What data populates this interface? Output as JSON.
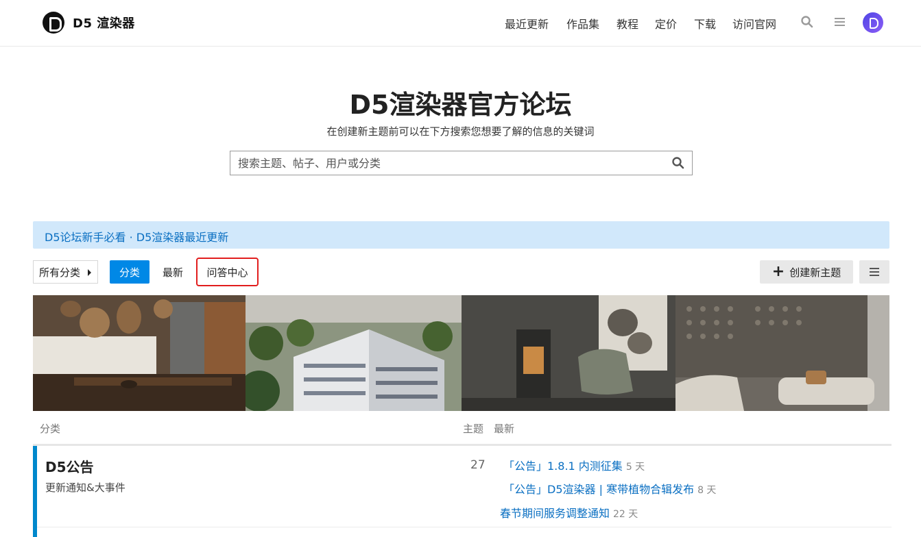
{
  "header": {
    "logo_text": "D5 渲染器",
    "nav": [
      "最近更新",
      "作品集",
      "教程",
      "定价",
      "下载",
      "访问官网"
    ]
  },
  "hero": {
    "title": "D5渲染器官方论坛",
    "subtitle": "在创建新主题前可以在下方搜索您想要了解的信息的关键词",
    "search_placeholder": "搜索主题、帖子、用户或分类"
  },
  "banner": {
    "text": "D5论坛新手必看 · D5渲染器最近更新"
  },
  "filters": {
    "dropdown": "所有分类",
    "categories": "分类",
    "latest": "最新",
    "qa": "问答中心",
    "create": "创建新主题"
  },
  "table": {
    "col_category": "分类",
    "col_topics": "主题",
    "col_latest": "最新"
  },
  "category": {
    "name": "D5公告",
    "description": "更新通知&大事件",
    "count": "27",
    "topics": [
      {
        "title": "「公告」1.8.1 内测征集",
        "age": "5 天"
      },
      {
        "title": "「公告」D5渲染器 | 寒带植物合辑发布",
        "age": "8 天"
      },
      {
        "title": "春节期间服务调整通知",
        "age": "22 天"
      }
    ]
  },
  "colors": {
    "accent": "#0088e6",
    "highlight": "#e11d1d",
    "banner_bg": "#d1e8fb"
  }
}
